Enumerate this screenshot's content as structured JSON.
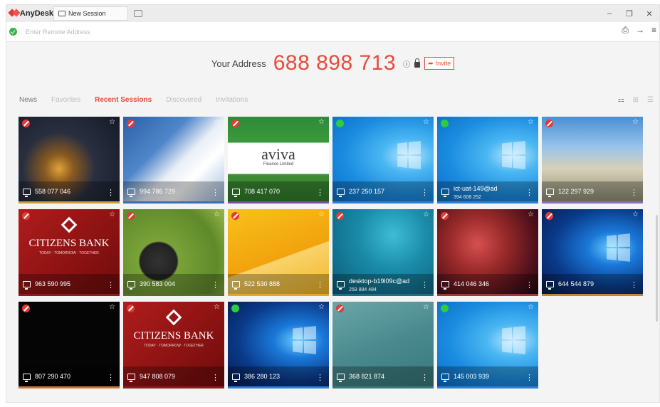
{
  "app": {
    "brand": "AnyDesk",
    "tab_label": "New Session",
    "window_controls": [
      "–",
      "❐",
      "✕"
    ]
  },
  "address_bar": {
    "placeholder": "Enter Remote Address",
    "status": "connected"
  },
  "your_address": {
    "label": "Your Address",
    "id": "688 898 713",
    "invite_label": "Invite"
  },
  "nav": {
    "tabs": [
      "News",
      "Favorites",
      "Recent Sessions",
      "Discovered",
      "Invitations"
    ],
    "active": "Recent Sessions"
  },
  "sessions": [
    {
      "id": "558 077 046",
      "status": "offline",
      "bg": "city",
      "strip": "#c9a23a"
    },
    {
      "id": "994 786 729",
      "status": "offline",
      "bg": "finance",
      "strip": "#3a6db5"
    },
    {
      "id": "708 417 070",
      "status": "offline",
      "bg": "aviva",
      "strip": "#7a4fa0",
      "logo_text": "aviva",
      "logo_sub": "Finance Limited"
    },
    {
      "id": "237 250 157",
      "status": "online",
      "bg": "win-light",
      "strip": "#2f7fd8"
    },
    {
      "id": "ict-uat-149@ad",
      "sub": "394 608 252",
      "status": "online",
      "bg": "win-light",
      "strip": "#2f7fd8"
    },
    {
      "id": "122 297 929",
      "status": "offline",
      "bg": "grass",
      "strip": "#8a6fc0"
    },
    {
      "id": "963 590 995",
      "status": "offline",
      "bg": "citizens",
      "strip": "#8b1d1d",
      "logo_text": "CITIZENS BANK",
      "logo_sub": "TODAY · TOMORROW · TOGETHER"
    },
    {
      "id": "390 583 004",
      "status": "offline",
      "bg": "stones",
      "strip": "#5b6b2b"
    },
    {
      "id": "522 530 888",
      "status": "offline",
      "bg": "yellow",
      "strip": "#e6a81e"
    },
    {
      "id": "desktop-b19l09c@ad",
      "sub": "259 884 484",
      "status": "offline",
      "bg": "underwater",
      "strip": "#1e6e8a"
    },
    {
      "id": "414 046 346",
      "status": "offline",
      "bg": "nebula",
      "strip": "#a03a3a"
    },
    {
      "id": "644 544 879",
      "status": "offline",
      "bg": "win-dark",
      "strip": "#c08a30"
    },
    {
      "id": "807 290 470",
      "status": "offline",
      "bg": "black",
      "strip": "#c9783a"
    },
    {
      "id": "947 808 079",
      "status": "offline",
      "bg": "citizens",
      "strip": "#8b1d1d",
      "logo_text": "CITIZENS BANK",
      "logo_sub": "TODAY · TOMORROW · TOGETHER"
    },
    {
      "id": "386 280 123",
      "status": "online",
      "bg": "win-dark",
      "strip": "#2f7fd8"
    },
    {
      "id": "368 821 874",
      "status": "offline",
      "bg": "teal",
      "strip": "#3a7a7a"
    },
    {
      "id": "145 003 939",
      "status": "online",
      "bg": "win-light",
      "strip": "#2f7fd8"
    }
  ],
  "colors": {
    "accent": "#e84a3c",
    "online": "#2ecc40",
    "offline": "#e53935"
  }
}
